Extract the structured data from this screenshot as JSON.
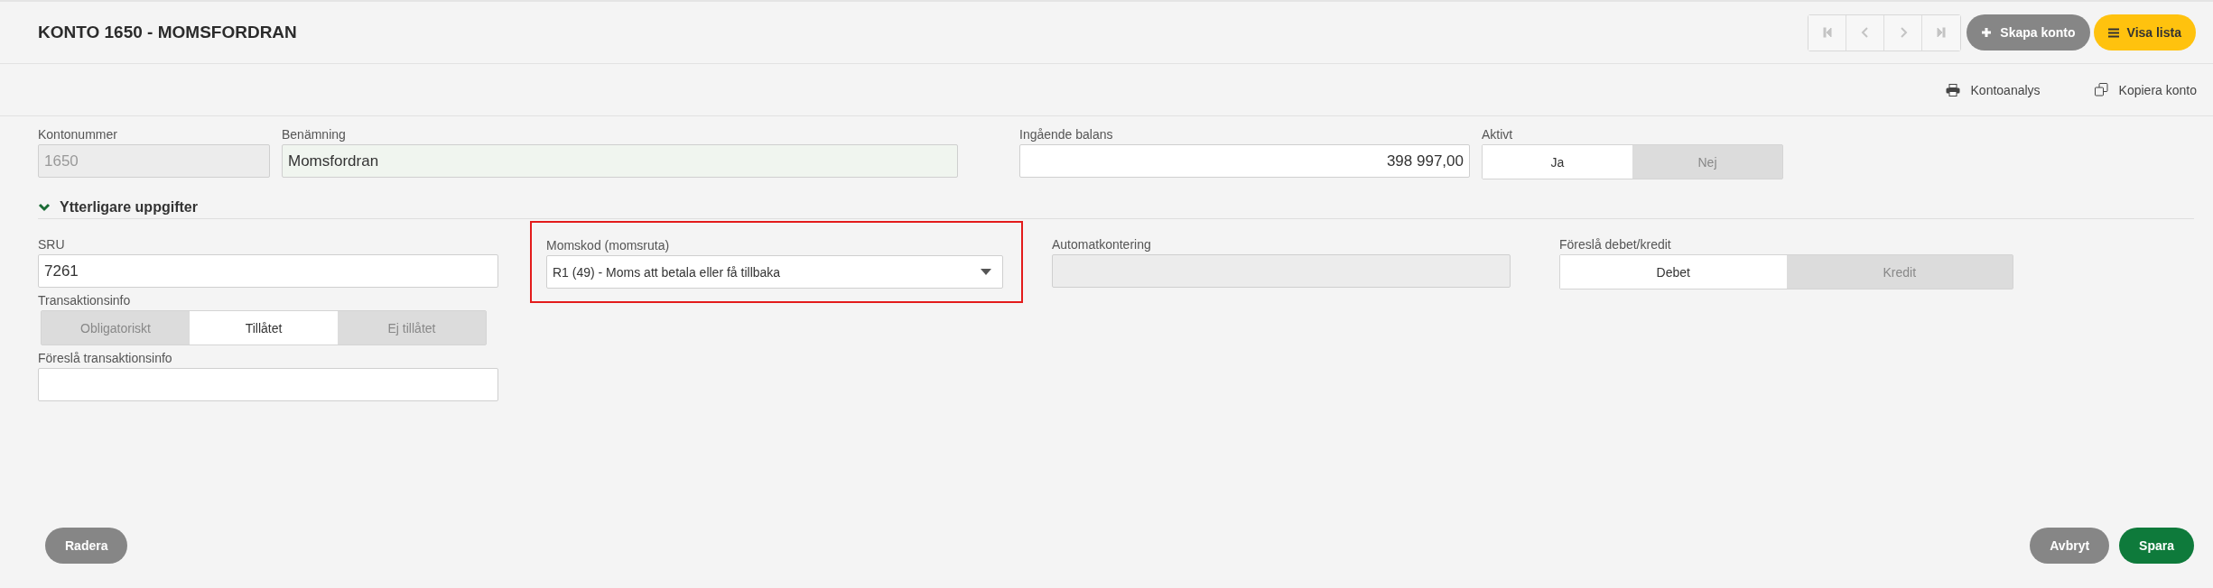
{
  "header": {
    "title": "KONTO 1650 - MOMSFORDRAN",
    "nav_buttons": [
      {
        "kind": "first",
        "disabled": true
      },
      {
        "kind": "prev",
        "disabled": true
      },
      {
        "kind": "next",
        "disabled": true
      },
      {
        "kind": "last",
        "disabled": true
      }
    ],
    "create_button": "Skapa konto",
    "list_button": "Visa lista"
  },
  "actions": [
    {
      "kind": "print",
      "label": "Kontoanalys"
    },
    {
      "kind": "copy",
      "label": "Kopiera konto"
    }
  ],
  "account_number": {
    "label": "Kontonummer",
    "value": "1650",
    "disabled": true
  },
  "name": {
    "label": "Benämning",
    "value": "Momsfordran"
  },
  "opening_balance": {
    "label": "Ingående balans",
    "value": "398 997,00"
  },
  "active": {
    "label": "Aktivt",
    "options": [
      {
        "label": "Ja",
        "selected": true
      },
      {
        "label": "Nej",
        "selected": false
      }
    ]
  },
  "section": {
    "title": "Ytterligare uppgifter",
    "expanded": true
  },
  "sru": {
    "label": "SRU",
    "value": "7261"
  },
  "vat_code": {
    "label": "Momskod (momsruta)",
    "value": "R1 (49) - Moms att betala eller få tillbaka",
    "highlighted": true
  },
  "auto_posting": {
    "label": "Automatkontering",
    "disabled": true
  },
  "suggest_debit_credit": {
    "label": "Föreslå debet/kredit",
    "options": [
      {
        "label": "Debet",
        "selected": true
      },
      {
        "label": "Kredit",
        "selected": false
      }
    ]
  },
  "transaction_info": {
    "label": "Transaktionsinfo",
    "options": [
      {
        "label": "Obligatoriskt",
        "selected": false
      },
      {
        "label": "Tillåtet",
        "selected": true
      },
      {
        "label": "Ej tillåtet",
        "selected": false
      }
    ]
  },
  "suggest_transaction_info": {
    "label": "Föreslå transaktionsinfo"
  },
  "footer": {
    "delete_button": "Radera",
    "cancel_button": "Avbryt",
    "save_button": "Spara"
  }
}
